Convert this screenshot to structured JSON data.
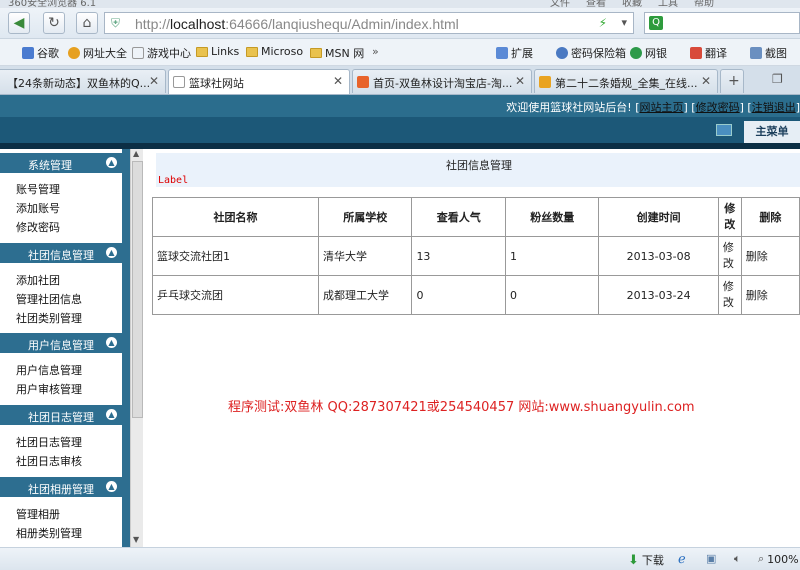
{
  "browser": {
    "title_partial": "360安全浏览器 6.1",
    "title_menu": [
      "文件",
      "查看",
      "收藏",
      "工具",
      "帮助"
    ],
    "url_host": "localhost",
    "url_rest": ":64666/lanqiushequ/Admin/index.html",
    "url_prefix": "http://",
    "bookmarks": [
      "谷歌",
      "网址大全",
      "游戏中心",
      "Links",
      "Microso",
      "MSN 网",
      "»"
    ],
    "bookmarks_right": [
      "扩展",
      "密码保险箱",
      "网银",
      "翻译",
      "截图"
    ],
    "tabs": [
      {
        "label": "【24条新动态】双鱼林的Q...",
        "active": false
      },
      {
        "label": "篮球社网站",
        "active": true
      },
      {
        "label": "首页-双鱼林设计淘宝店-淘...",
        "active": false
      },
      {
        "label": "第二十二条婚规_全集_在线...",
        "active": false
      }
    ],
    "status": {
      "download": "下载",
      "zoom": "100%"
    }
  },
  "header": {
    "welcome": "欢迎使用篮球社网站后台!",
    "link_home": "网站主页",
    "link_pwd": "修改密码",
    "link_logout": "注销退出",
    "main_menu": "主菜单"
  },
  "sidebar": {
    "groups": [
      {
        "title": "系统管理",
        "items": [
          "账号管理",
          "添加账号",
          "修改密码"
        ]
      },
      {
        "title": "社团信息管理",
        "items": [
          "添加社团",
          "管理社团信息",
          "社团类别管理"
        ]
      },
      {
        "title": "用户信息管理",
        "items": [
          "用户信息管理",
          "用户审核管理"
        ]
      },
      {
        "title": "社团日志管理",
        "items": [
          "社团日志管理",
          "社团日志审核"
        ]
      },
      {
        "title": "社团相册管理",
        "items": [
          "管理相册",
          "相册类别管理"
        ]
      }
    ]
  },
  "content": {
    "title": "社团信息管理",
    "label": "Label",
    "columns": [
      "社团名称",
      "所属学校",
      "查看人气",
      "粉丝数量",
      "创建时间",
      "修改",
      "删除"
    ],
    "rows": [
      [
        "篮球交流社团1",
        "清华大学",
        "13",
        "1",
        "2013-03-08",
        "修改",
        "删除"
      ],
      [
        "乒乓球交流团",
        "成都理工大学",
        "0",
        "0",
        "2013-03-24",
        "修改",
        "删除"
      ]
    ],
    "promo": "程序测试:双鱼林 QQ:287307421或254540457 网站:www.shuangyulin.com"
  }
}
